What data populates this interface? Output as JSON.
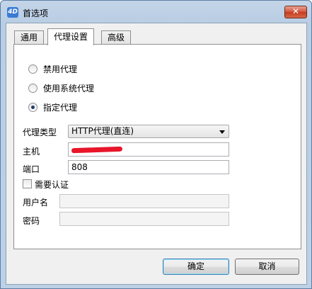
{
  "window": {
    "title": "首选项",
    "app_icon": "app-logo-icon",
    "close_glyph": "✕"
  },
  "tabs": [
    {
      "label": "通用"
    },
    {
      "label": "代理设置"
    },
    {
      "label": "高级"
    }
  ],
  "proxy": {
    "options": [
      {
        "label": "禁用代理",
        "checked": false
      },
      {
        "label": "使用系统代理",
        "checked": false
      },
      {
        "label": "指定代理",
        "checked": true
      }
    ],
    "type_label": "代理类型",
    "type_value": "HTTP代理(直连)",
    "host_label": "主机",
    "port_label": "端口",
    "port_value": "808",
    "auth_label": "需要认证",
    "auth_checked": false,
    "username_label": "用户名",
    "username_value": "",
    "password_label": "密码",
    "password_value": ""
  },
  "buttons": {
    "ok": "确定",
    "cancel": "取消"
  }
}
